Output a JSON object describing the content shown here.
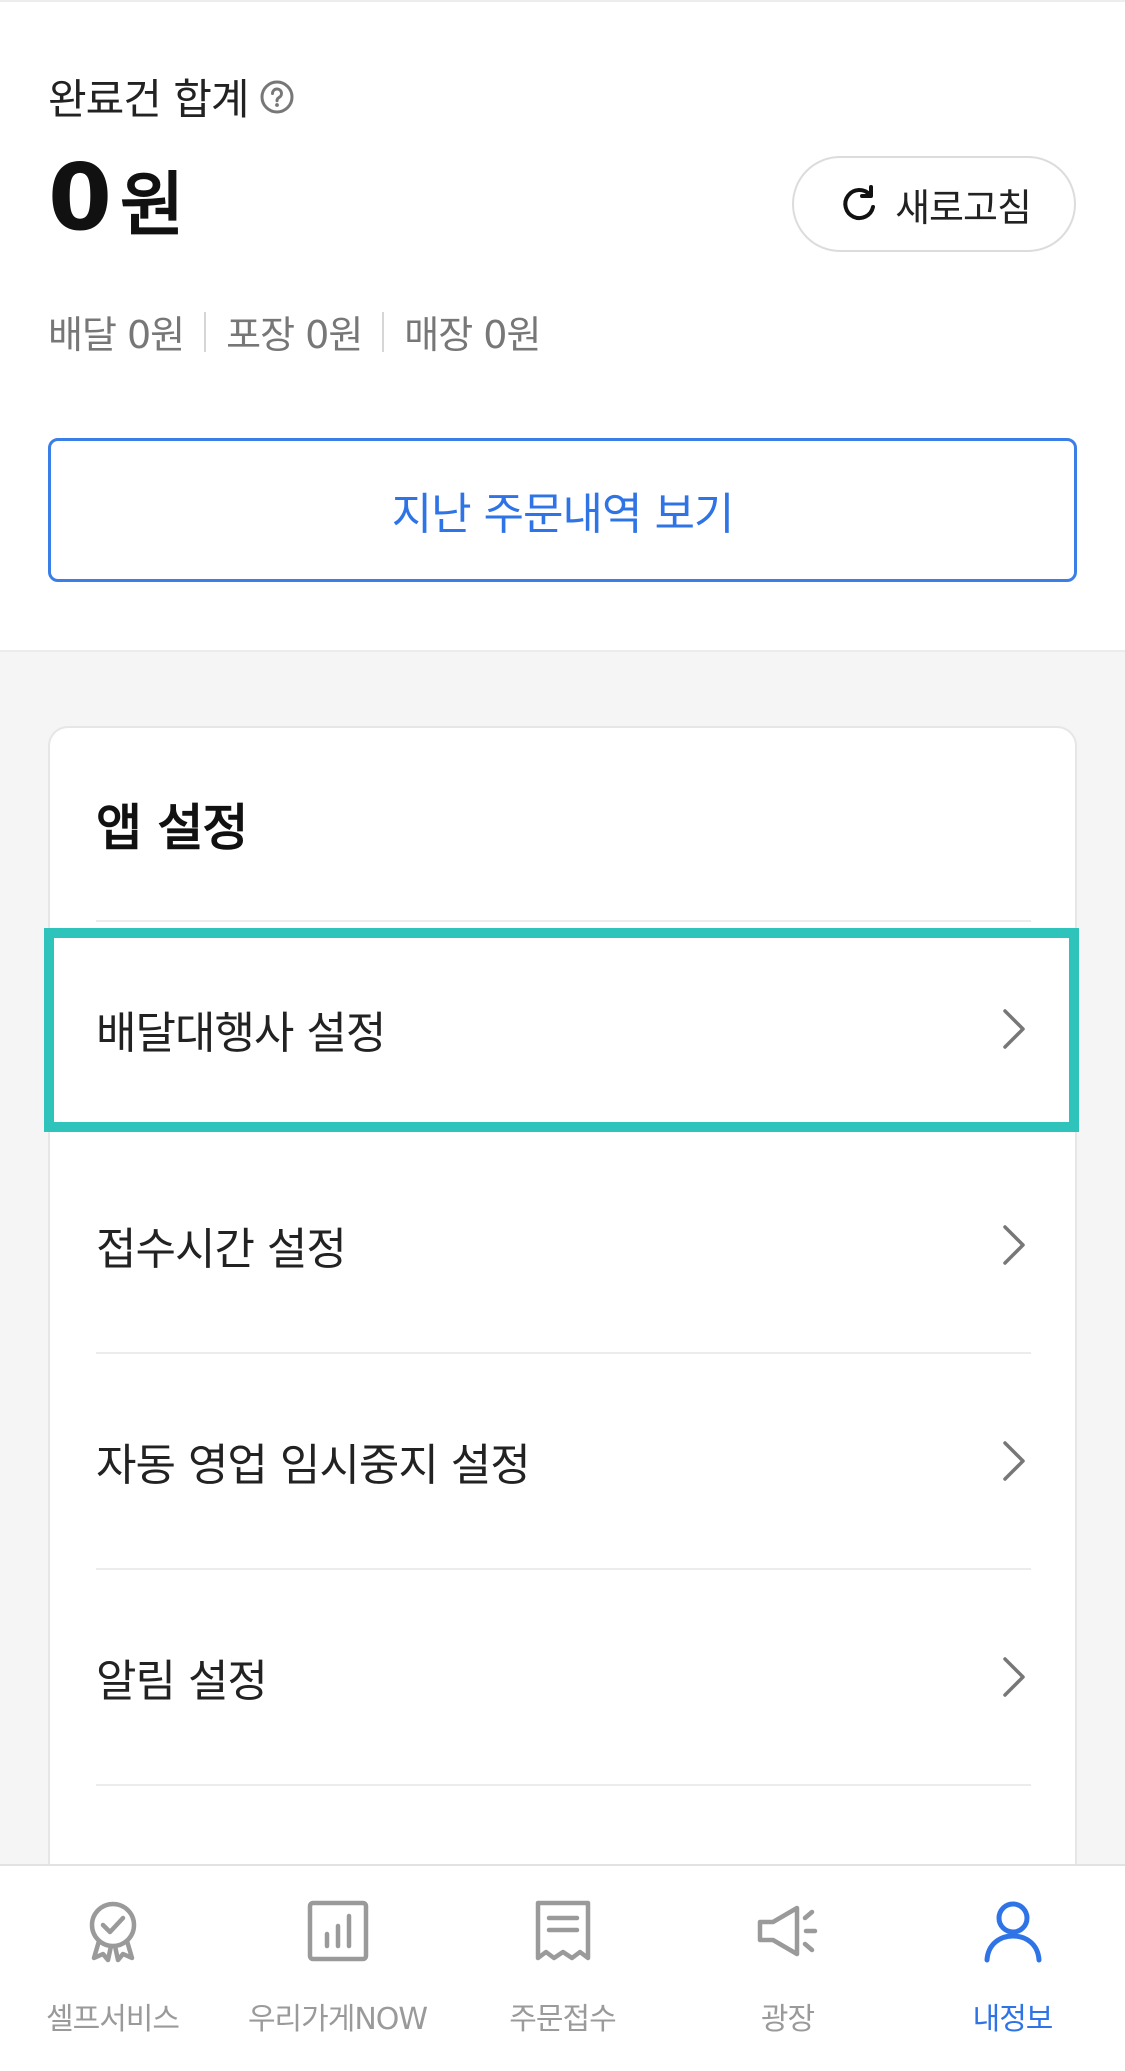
{
  "summary": {
    "label": "완료건 합계",
    "total_value": "0",
    "total_unit": "원",
    "refresh_label": "새로고침",
    "breakdown": [
      {
        "text": "배달 0원"
      },
      {
        "text": "포장 0원"
      },
      {
        "text": "매장 0원"
      }
    ],
    "history_button": "지난 주문내역 보기"
  },
  "app_settings": {
    "title": "앱 설정",
    "items": [
      {
        "label": "배달대행사 설정",
        "highlighted": true
      },
      {
        "label": "접수시간 설정"
      },
      {
        "label": "자동 영업 임시중지 설정"
      },
      {
        "label": "알림 설정"
      }
    ]
  },
  "tabbar": {
    "tabs": [
      {
        "label": "셀프서비스",
        "icon": "badge-check-icon"
      },
      {
        "label": "우리가게NOW",
        "icon": "bar-chart-icon"
      },
      {
        "label": "주문접수",
        "icon": "receipt-icon"
      },
      {
        "label": "광장",
        "icon": "megaphone-icon"
      },
      {
        "label": "내정보",
        "icon": "person-icon",
        "active": true
      }
    ]
  },
  "colors": {
    "accent": "#2f74e6",
    "highlight": "#2ec4bb",
    "muted": "#9a9a9a"
  }
}
